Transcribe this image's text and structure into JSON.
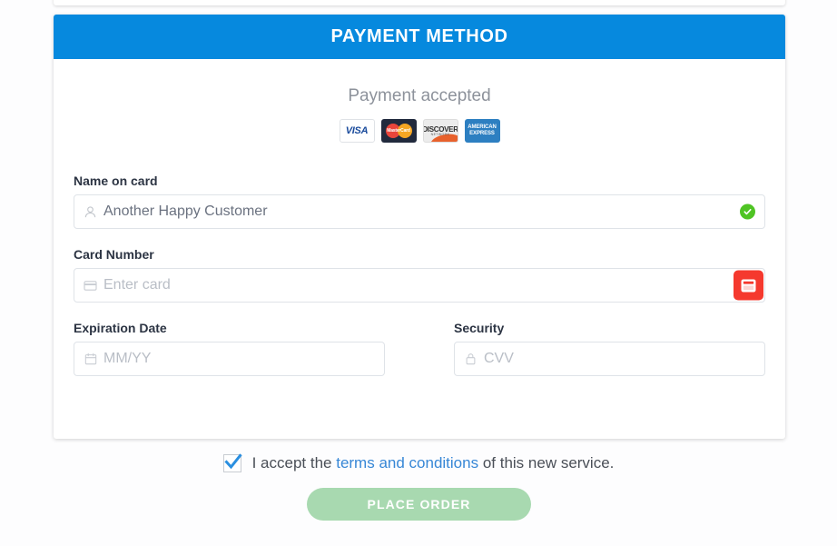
{
  "header": {
    "title": "PAYMENT METHOD"
  },
  "accepted": {
    "text": "Payment accepted"
  },
  "cards": [
    {
      "name": "visa-logo",
      "label": "VISA"
    },
    {
      "name": "mastercard-logo",
      "label": "MasterCard"
    },
    {
      "name": "discover-logo",
      "label": "DISCOVER",
      "sub": "NETWORK"
    },
    {
      "name": "amex-logo",
      "line1": "AMERICAN",
      "line2": "EXPRESS"
    }
  ],
  "fields": {
    "name_on_card": {
      "label": "Name on card",
      "value": "Another Happy Customer",
      "icon": "user-icon",
      "valid": true
    },
    "card_number": {
      "label": "Card Number",
      "value": "",
      "placeholder": "Enter card",
      "icon": "credit-card-icon"
    },
    "expiration": {
      "label": "Expiration Date",
      "value": "",
      "placeholder": "MM/YY",
      "icon": "calendar-icon"
    },
    "security": {
      "label": "Security",
      "value": "",
      "placeholder": "CVV",
      "icon": "lock-icon"
    }
  },
  "terms": {
    "checked": true,
    "prefix": "I accept the",
    "link": "terms and conditions",
    "suffix": "of this new service."
  },
  "submit": {
    "label": "PLACE ORDER",
    "enabled": false
  },
  "colors": {
    "header_blue": "#0689de",
    "accent_link": "#3787d6",
    "valid_green": "#4fc424",
    "error_red": "#f5392e",
    "button_green": "#a8d9b0"
  }
}
